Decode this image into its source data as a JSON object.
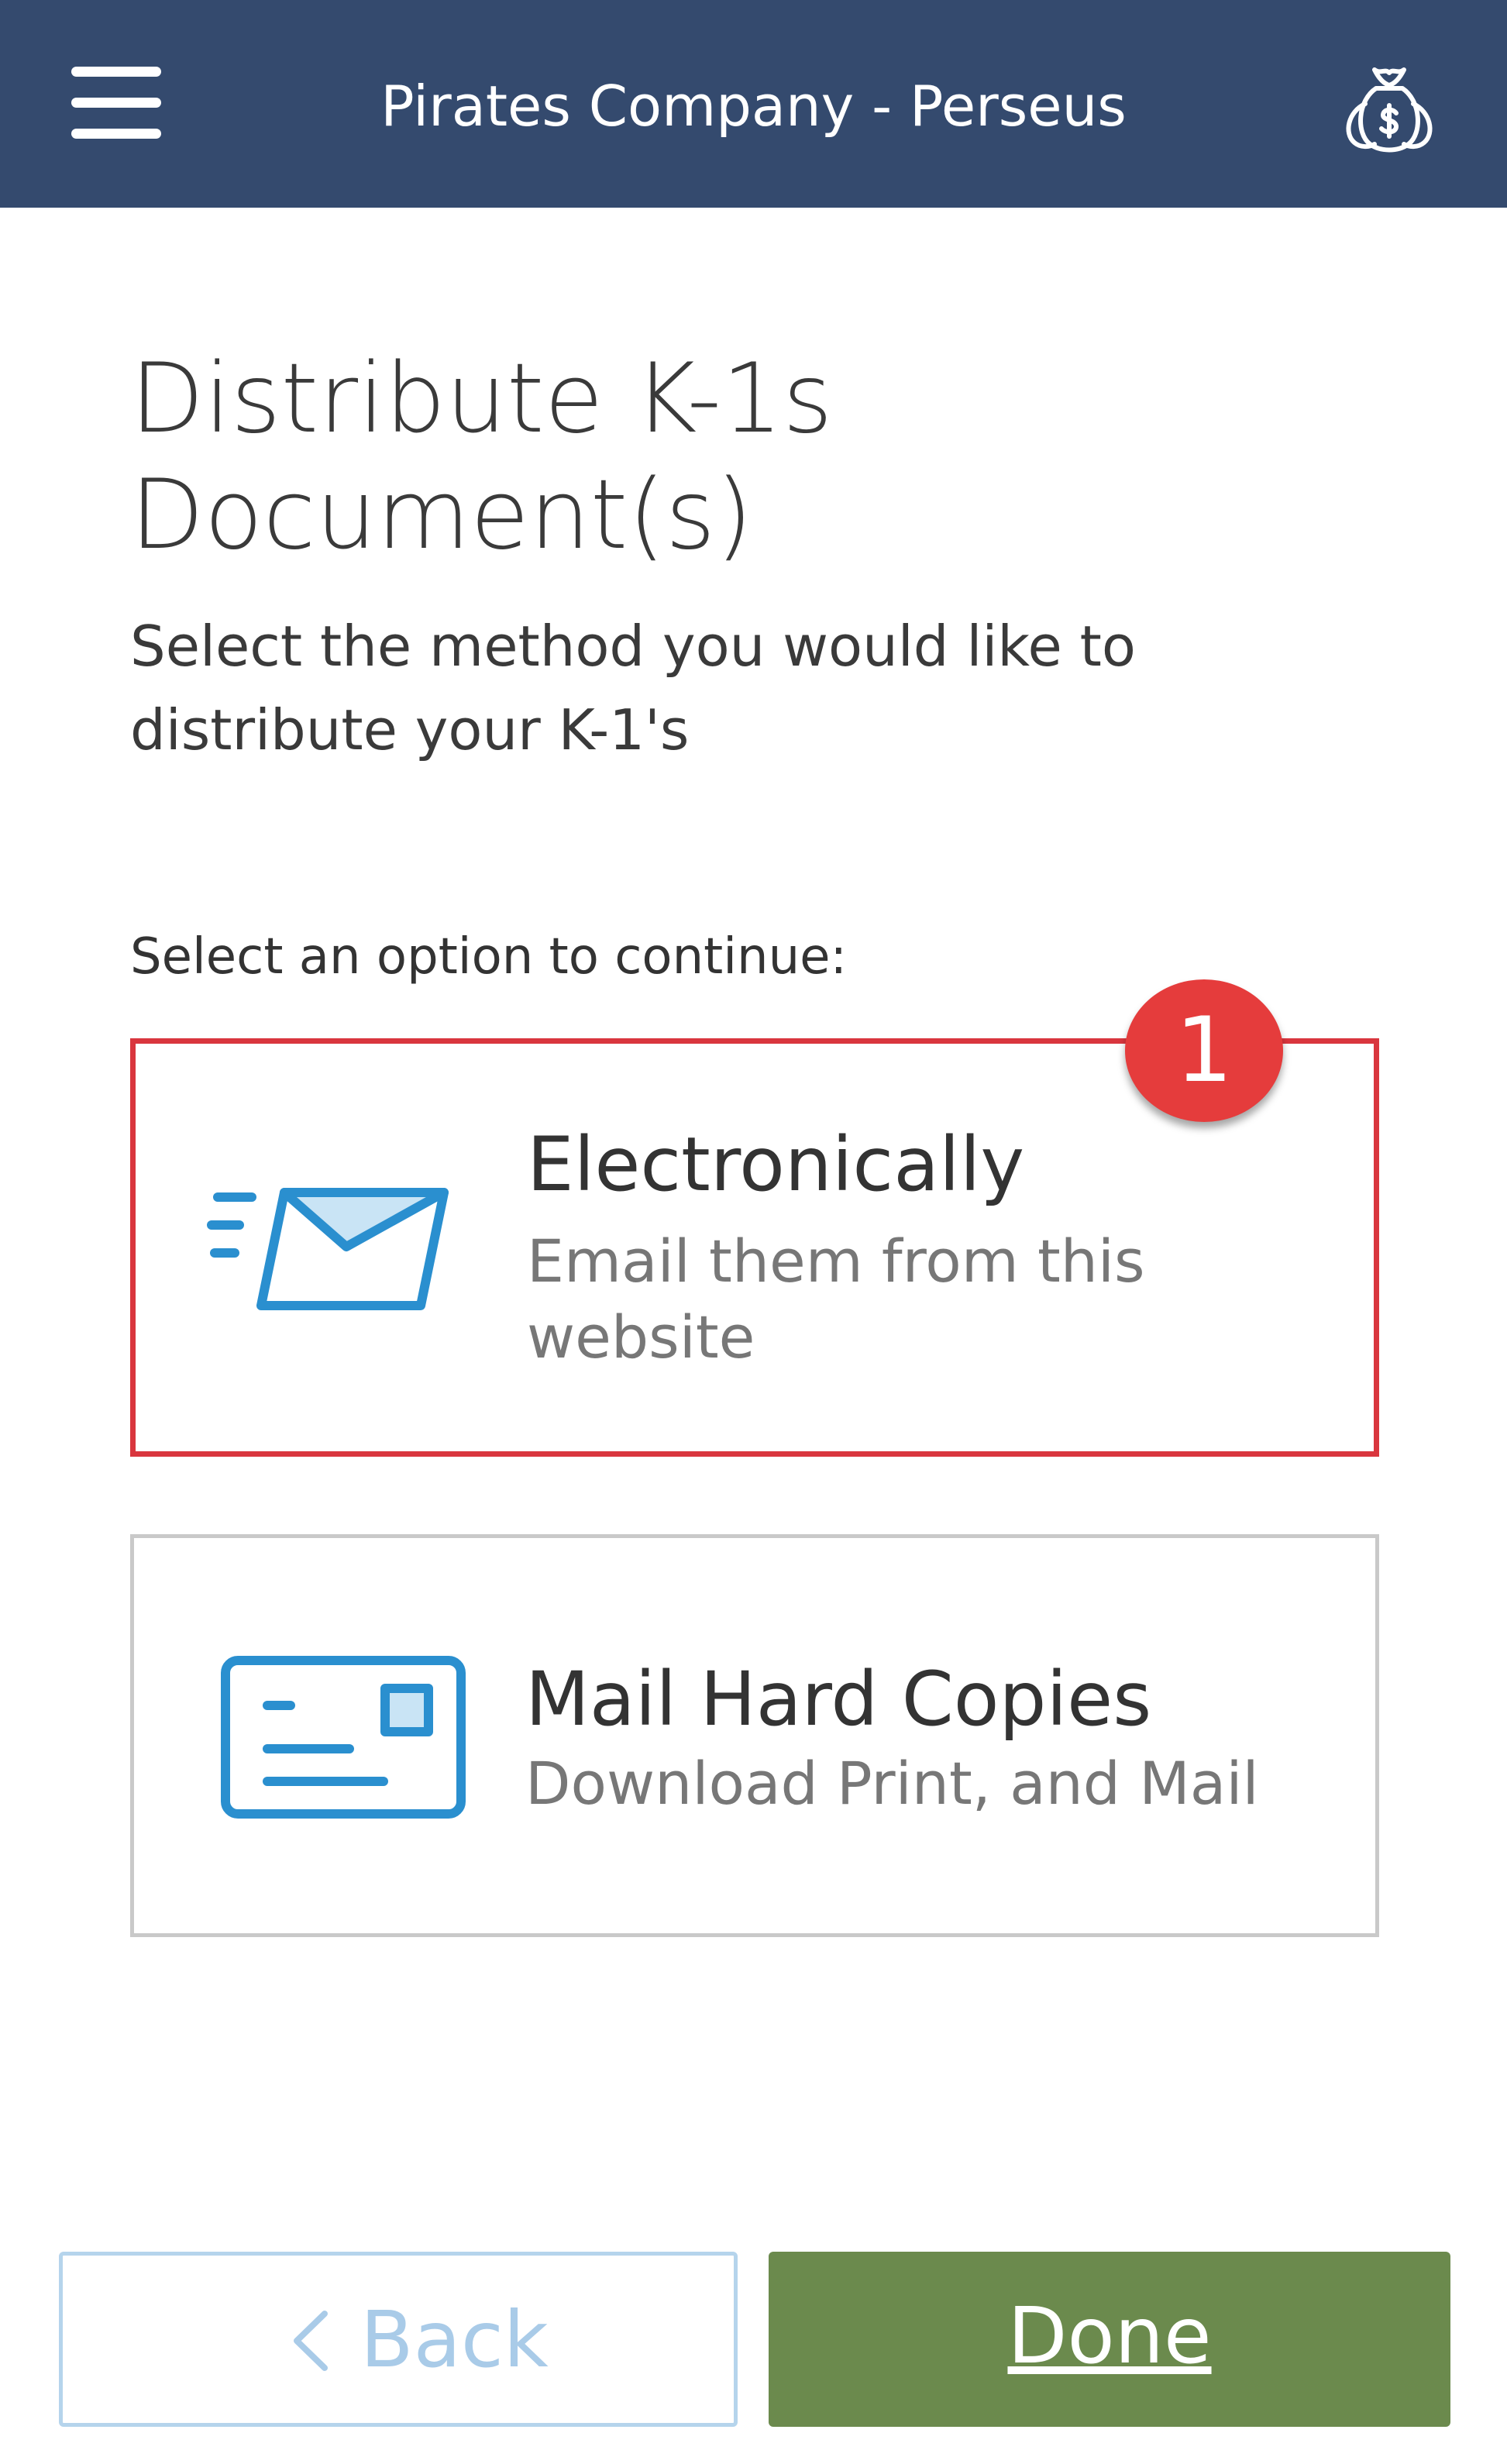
{
  "header": {
    "title": "Pirates Company - Perseus",
    "menu_icon": "hamburger-menu-icon",
    "right_icon": "money-bag-icon",
    "background_color": "#344a6e"
  },
  "page": {
    "title_line1": "Distribute K-1s",
    "title_line2": "Document(s)",
    "subtitle_line1": "Select the method you would like to",
    "subtitle_line2": "distribute your K-1's",
    "option_prompt": "Select an option to continue:"
  },
  "options": [
    {
      "title": "Electronically",
      "description_line1": "Email them from this",
      "description_line2": "website",
      "icon": "email-envelope-icon",
      "highlighted": true,
      "highlight_color": "#d9363e",
      "step_badge": "1"
    },
    {
      "title": "Mail Hard Copies",
      "description": "Download Print, and Mail",
      "icon": "postcard-mail-icon",
      "highlighted": false
    }
  ],
  "footer": {
    "back_label": "Back",
    "back_icon": "chevron-left-icon",
    "done_label": "Done",
    "done_color": "#6b8a4d",
    "back_border_color": "#b5d4ec"
  },
  "colors": {
    "icon_blue": "#2a8fcf",
    "icon_fill_light": "#c9e4f5",
    "badge_red": "#e53c3c"
  }
}
